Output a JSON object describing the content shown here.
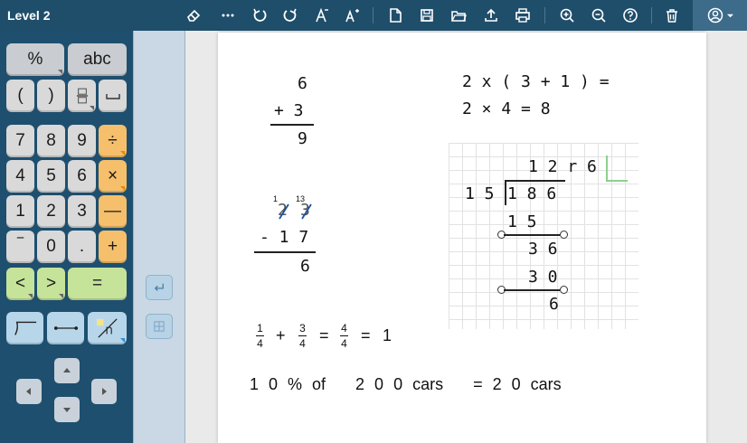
{
  "title": "Level 2",
  "toolbar": {
    "icons": [
      "eraser-icon",
      "more-icon",
      "undo-icon",
      "redo-icon",
      "font-decrease-icon",
      "font-increase-icon",
      "new-file-icon",
      "save-icon",
      "open-folder-icon",
      "upload-icon",
      "print-icon",
      "zoom-in-icon",
      "zoom-out-icon",
      "help-icon",
      "trash-icon",
      "account-icon"
    ]
  },
  "keypad": {
    "row1": [
      "%",
      "abc"
    ],
    "row2": [
      "(",
      ")"
    ],
    "row3": [
      "7",
      "8",
      "9",
      "÷"
    ],
    "row4": [
      "4",
      "5",
      "6",
      "×"
    ],
    "row5": [
      "1",
      "2",
      "3",
      "—"
    ],
    "row6": [
      "‾",
      "0",
      ".",
      "+"
    ],
    "row7": [
      "<",
      ">",
      "="
    ]
  },
  "math": {
    "add": {
      "top": "6",
      "op": "+ 3",
      "result": "9"
    },
    "sub": {
      "carry1": "1",
      "carry2": "13",
      "top_a": "2",
      "top_b": "3",
      "op": "- 1 7",
      "result": "6"
    },
    "expr1": "2 x ( 3 + 1 ) =",
    "expr2": "2 × 4 = 8",
    "division": {
      "quotient": "1 2 r 6",
      "divisor": "1 5",
      "dividend": "1 8 6",
      "step1": "1 5",
      "step2": "3 6",
      "step3": "3 0",
      "remainder": "6"
    },
    "fraction": {
      "a_num": "1",
      "a_den": "4",
      "plus": "+",
      "b_num": "3",
      "b_den": "4",
      "eq": "=",
      "c_num": "4",
      "c_den": "4",
      "eq2": "=",
      "result": "1"
    },
    "percent": "1 0 % of   2 0 0 cars   = 2 0 cars"
  },
  "colors": {
    "topbar": "#1f4e6b",
    "keypad": "#1e4f6f",
    "orange_key": "#f5bf6c",
    "green_key": "#c6e39a",
    "strike": "#1a4fa0"
  }
}
